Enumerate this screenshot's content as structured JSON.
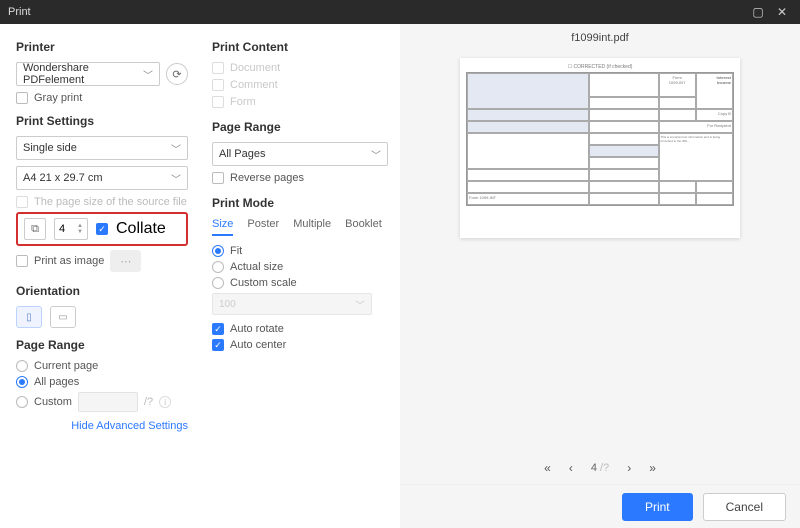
{
  "window": {
    "title": "Print"
  },
  "printer": {
    "heading": "Printer",
    "selected": "Wondershare PDFelement",
    "gray_print": "Gray print"
  },
  "print_settings": {
    "heading": "Print Settings",
    "sides": "Single side",
    "paper": "A4 21 x 29.7 cm",
    "page_size_note": "The page size of the source file",
    "copies": "4",
    "collate": "Collate",
    "print_as_image": "Print as image"
  },
  "orientation": {
    "heading": "Orientation"
  },
  "page_range_left": {
    "heading": "Page Range",
    "current": "Current page",
    "all": "All pages",
    "custom": "Custom",
    "sep": "/?"
  },
  "advanced_link": "Hide Advanced Settings",
  "print_content": {
    "heading": "Print Content",
    "items": [
      "Document",
      "Comment",
      "Form"
    ]
  },
  "page_range_mid": {
    "heading": "Page Range",
    "selected": "All Pages",
    "reverse": "Reverse pages"
  },
  "print_mode": {
    "heading": "Print Mode",
    "tabs": [
      "Size",
      "Poster",
      "Multiple",
      "Booklet"
    ],
    "fit": "Fit",
    "actual": "Actual size",
    "custom_scale": "Custom scale",
    "scale_value": "100",
    "auto_rotate": "Auto rotate",
    "auto_center": "Auto center"
  },
  "preview": {
    "filename": "f1099int.pdf",
    "corrected": "CORRECTED (if checked)",
    "form_num": "1099-INT",
    "form_title1": "Interest",
    "form_title2": "Income",
    "copy": "Copy B",
    "recipient": "For Recipient",
    "current_page": "4",
    "total_sep": "/?"
  },
  "footer": {
    "print": "Print",
    "cancel": "Cancel"
  }
}
